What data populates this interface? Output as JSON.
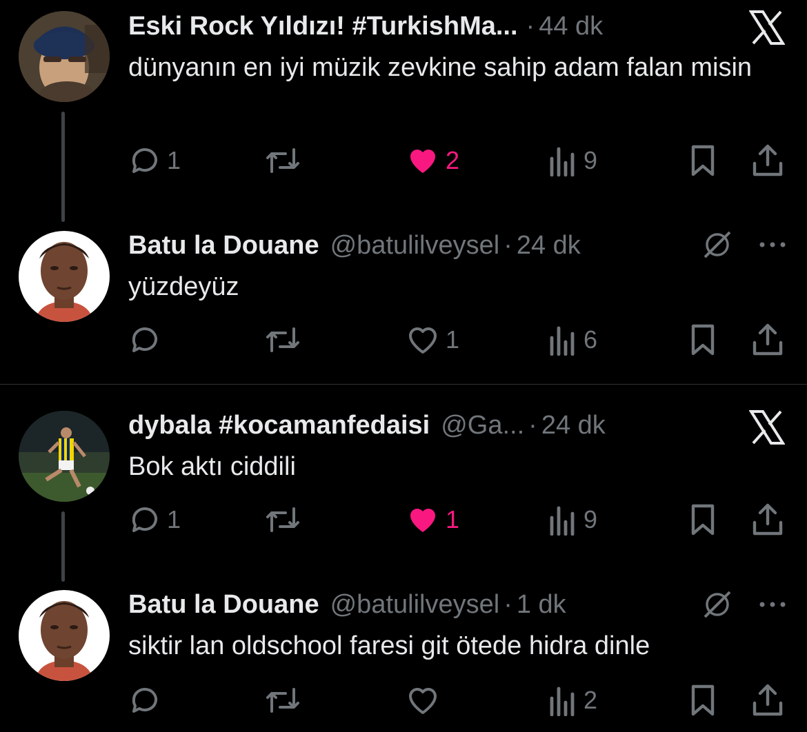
{
  "colors": {
    "background": "#000000",
    "text": "#e7e9ea",
    "muted": "#71767b",
    "like": "#f91880",
    "divider": "#2f3336"
  },
  "threads": [
    {
      "tweets": [
        {
          "name": "Eski Rock Yıldızı! #TurkishMa...",
          "handle": "",
          "time": "44 dk",
          "text": "dünyanın en iyi müzik zevkine sahip adam falan misin",
          "top_icon": "x-logo-icon",
          "stats": {
            "replies": "1",
            "retweets": "",
            "likes": "2",
            "liked": true,
            "views": "9"
          }
        },
        {
          "name": "Batu la Douane",
          "handle": "@batulilveysel",
          "time": "24 dk",
          "text": "yüzdeyüz",
          "top_icon": "grok-icon",
          "stats": {
            "replies": "",
            "retweets": "",
            "likes": "1",
            "liked": false,
            "views": "6"
          }
        }
      ]
    },
    {
      "tweets": [
        {
          "name": "dybala #kocamanfedaisi",
          "handle": "@Ga...",
          "time": "24 dk",
          "text": "Bok aktı ciddili",
          "top_icon": "x-logo-icon",
          "stats": {
            "replies": "1",
            "retweets": "",
            "likes": "1",
            "liked": true,
            "views": "9"
          }
        },
        {
          "name": "Batu la Douane",
          "handle": "@batulilveysel",
          "time": "1 dk",
          "text": "siktir lan oldschool faresi git ötede hidra dinle",
          "top_icon": "grok-icon",
          "stats": {
            "replies": "",
            "retweets": "",
            "likes": "",
            "liked": false,
            "views": "2"
          }
        }
      ]
    }
  ]
}
